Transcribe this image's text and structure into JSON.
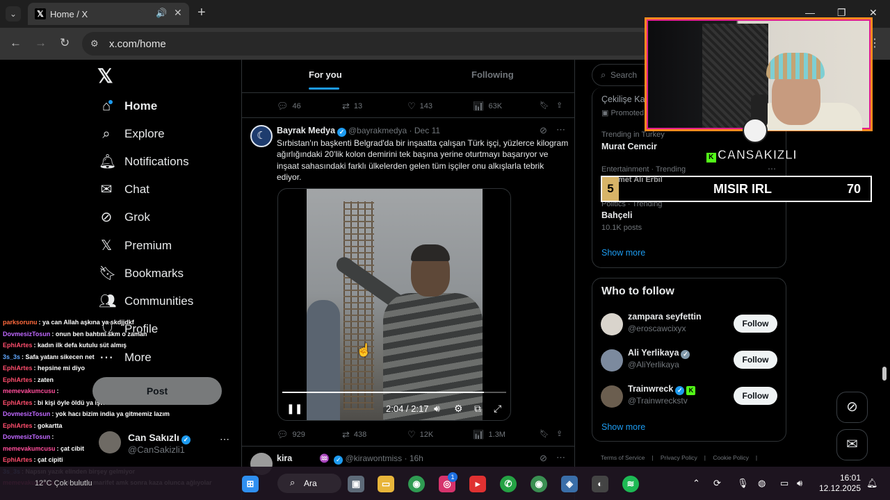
{
  "browser": {
    "tab_title": "Home / X",
    "url": "x.com/home",
    "favicon": "x-logo"
  },
  "sidebar": {
    "items": [
      {
        "label": "Home",
        "icon": "home-icon"
      },
      {
        "label": "Explore",
        "icon": "search-icon"
      },
      {
        "label": "Notifications",
        "icon": "bell-icon"
      },
      {
        "label": "Chat",
        "icon": "mail-icon"
      },
      {
        "label": "Grok",
        "icon": "grok-icon"
      },
      {
        "label": "Premium",
        "icon": "x-icon"
      },
      {
        "label": "Bookmarks",
        "icon": "bookmark-icon"
      },
      {
        "label": "Communities",
        "icon": "people-icon"
      },
      {
        "label": "Profile",
        "icon": "person-icon"
      },
      {
        "label": "More",
        "icon": "more-icon"
      }
    ],
    "post_label": "Post",
    "account": {
      "name": "Can Sakızlı",
      "handle": "@CanSakizli1"
    }
  },
  "feed": {
    "tabs": [
      "For you",
      "Following"
    ],
    "prev_actions": {
      "replies": "46",
      "reposts": "13",
      "likes": "143",
      "views": "63K"
    },
    "tweet": {
      "author": "Bayrak Medya",
      "handle": "@bayrakmedya",
      "date": "Dec 11",
      "text": "Sırbistan'ın başkenti Belgrad'da bir inşaatta çalışan Türk işçi, yüzlerce kilogram ağırlığındaki 20'lik kolon demirini tek başına yerine oturtmayı başarıyor ve inşaat sahasındaki farklı ülkelerden gelen tüm işçiler onu alkışlarla tebrik ediyor.",
      "video_time": "2:04 / 2:17",
      "video_progress": 0.9,
      "actions": {
        "replies": "929",
        "reposts": "438",
        "likes": "12K",
        "views": "1.3M"
      }
    },
    "next_tweet": {
      "author": "kira",
      "handle": "@kirawontmiss",
      "date": "16h"
    }
  },
  "right": {
    "search_placeholder": "Search",
    "promo_text": "Çekilişe Katıl",
    "promoted_label": "Promoted by",
    "trends": [
      {
        "context": "Trending in Turkey",
        "title": "Murat Cemcir",
        "posts": ""
      },
      {
        "context": "Entertainment · Trending",
        "title": "met Ali Erbil",
        "posts": ""
      },
      {
        "context": "Politics · Trending",
        "title": "Bahçeli",
        "posts": "10.1K posts"
      }
    ],
    "show_more": "Show more",
    "who_to_follow": {
      "title": "Who to follow",
      "follow_label": "Follow",
      "users": [
        {
          "name": "zampara seyfettin",
          "handle": "@eroscawcixyx",
          "verified": false
        },
        {
          "name": "Ali Yerlikaya",
          "handle": "@AliYerlikaya",
          "verified": true
        },
        {
          "name": "Trainwreck",
          "handle": "@Trainwreckstv",
          "verified": true
        }
      ],
      "show_more": "Show more"
    },
    "footer": [
      "Terms of Service",
      "Privacy Policy",
      "Cookie Policy"
    ]
  },
  "stream": {
    "streamer_name": "CANSAKIZLI",
    "score_rank": "5",
    "score_label": "MISIR IRL",
    "score_value": "70",
    "chat": [
      {
        "user": "parksorunu",
        "msg": ": ya can Allah aşkına ya skdjjdkf",
        "color": "#ff6a3d"
      },
      {
        "user": "DovmesizTosun",
        "msg": ": onun ben bahtını skm o zaman",
        "color": "#c068ff"
      },
      {
        "user": "EphiArtes",
        "msg": ": kadın ilk defa kutulu süt almış",
        "color": "#ff4d6d"
      },
      {
        "user": "3s_3s",
        "msg": ": Safa yatanı sikecen net",
        "color": "#61a8ff"
      },
      {
        "user": "EphiArtes",
        "msg": ": hepsine mi diyo",
        "color": "#ff4d6d"
      },
      {
        "user": "EphiArtes",
        "msg": ": zaten",
        "color": "#ff4d6d"
      },
      {
        "user": "memevakumcusu",
        "msg": ":",
        "color": "#ff4d9a"
      },
      {
        "user": "EphiArtes",
        "msg": ": bi kişi öyle öldü ya işte",
        "color": "#ff4d6d"
      },
      {
        "user": "DovmesizTosun",
        "msg": ": yok hacı bizim india ya gitmemiz lazım",
        "color": "#c068ff"
      },
      {
        "user": "EphiArtes",
        "msg": ": gokartta",
        "color": "#ff4d6d"
      },
      {
        "user": "DovmesizTosun",
        "msg": ":",
        "color": "#c068ff"
      },
      {
        "user": "memevakumcusu",
        "msg": ": çat cibit",
        "color": "#ff4d9a"
      },
      {
        "user": "EphiArtes",
        "msg": ": çat cipiti",
        "color": "#ff4d6d"
      },
      {
        "user": "3s_3s",
        "msg": ": Napsın yazık elinden birşey gelmiyor",
        "color": "#61a8ff"
      },
      {
        "user": "memevakumcusu",
        "msg": ": çok büyük marifet amk sonra kaza olunca ağlıyolar",
        "color": "#ff4d9a"
      }
    ]
  },
  "taskbar": {
    "search_label": "Ara",
    "weather": "12°C",
    "weather_desc": "Çok bulutlu",
    "time": "16:01",
    "date": "12.12.2025",
    "notification_count": "1"
  },
  "colors": {
    "accent": "#1d9bf0",
    "background": "#000000",
    "border": "#2f3336",
    "muted": "#71767b"
  }
}
